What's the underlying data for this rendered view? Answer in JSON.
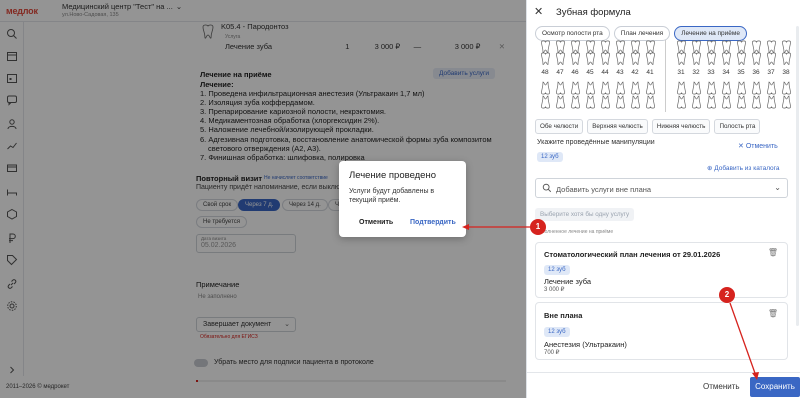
{
  "header": {
    "logo": "медлок",
    "clinic_name": "Медицинский центр \"Тест\" на ...",
    "clinic_address": "ул.Ново-Садовая, 135"
  },
  "footer": {
    "text": "2011–2026 © медрокет"
  },
  "service": {
    "title": "K05.4 - Пародонтоз",
    "sub_label": "Услуга",
    "name": "Лечение зуба",
    "qty": "1",
    "price": "3 000 ₽",
    "discount": "—",
    "total": "3 000 ₽"
  },
  "treatment": {
    "header": "Лечение на приёме",
    "add_button": "Добавить услуги",
    "lines": [
      "Лечение:",
      "1. Проведена инфильтрационная анестезия (Ультракаин 1,7 мл)",
      "2. Изоляция зуба коффердамом.",
      "3. Препарирование кариозной полости, некрэктомия.",
      "4. Медикаментозная обработка (хлоргексидин 2%).",
      "5. Наложение лечебной/изолирующей прокладки.",
      "6. Адгезивная подготовка, восстановление анатомической формы зуба композитом",
      "   светового отверждения (A2, A3).",
      "7. Финишная обработка: шлифовка, полировка"
    ]
  },
  "repeat_visit": {
    "header": "Повторный визит",
    "hint": "Не начисляет соответствие",
    "note": "Пациенту придёт напоминание, если выклю...",
    "chips": [
      "Свой срок",
      "Через 7 д.",
      "Через 14 д.",
      "Через..."
    ],
    "not_required": "Не требуется",
    "date_label": "Дата визита",
    "date_value": "05.02.2026"
  },
  "note_section": {
    "header": "Примечание",
    "value": "Не заполнено",
    "select_value": "Завершает документ",
    "warn": "Обязательно для ЕГИСЗ",
    "checkbox_label": "Убрать место для подписи пациента в протоколе"
  },
  "modal": {
    "title": "Лечение проведено",
    "text": "Услуги будут добавлены в текущий приём.",
    "cancel": "Отменить",
    "confirm": "Подтвердить"
  },
  "panel": {
    "title": "Зубная формула",
    "tabs": [
      "Осмотр полости рта",
      "План лечения",
      "Лечение на приёме"
    ],
    "active_tab": 2,
    "teeth_left": [
      "48",
      "47",
      "46",
      "45",
      "44",
      "43",
      "42",
      "41"
    ],
    "teeth_right": [
      "31",
      "32",
      "33",
      "34",
      "35",
      "36",
      "37",
      "38"
    ],
    "jaw_buttons": [
      "Обе челюсти",
      "Верхняя челюсть",
      "Нижняя челюсть",
      "Полость рта"
    ],
    "manip_label": "Укажите проведённые манипуляции",
    "cancel_label": "Отменить",
    "selected_tooth": "12 зуб",
    "add_catalog": "Добавить из каталога",
    "search_placeholder": "Добавить услуги вне плана",
    "pick_button": "Выберите хотя бы одну услугу",
    "tiny_note": "Выполненное лечение на приёме",
    "cards": [
      {
        "title": "Стоматологический план лечения от 29.01.2026",
        "tooth": "12 зуб",
        "name": "Лечение зуба",
        "price": "3 000 ₽"
      },
      {
        "title": "Вне плана",
        "tooth": "12 зуб",
        "name": "Анестезия (Ультракаин)",
        "price": "700 ₽"
      }
    ],
    "footer_cancel": "Отменить",
    "footer_save": "Сохранить"
  },
  "annotations": {
    "marker_1": "1",
    "marker_2": "2",
    "color": "#d6231e"
  },
  "colors": {
    "accent": "#3a67c4",
    "brand": "#e2493b"
  }
}
